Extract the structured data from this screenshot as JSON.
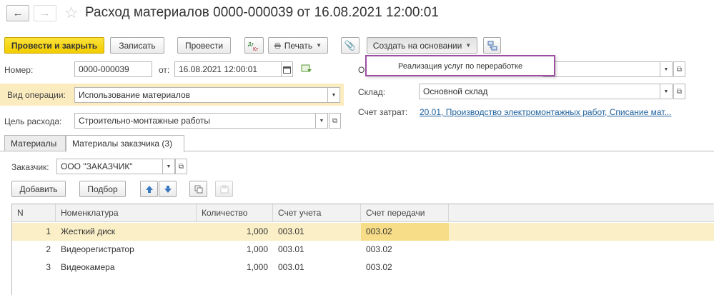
{
  "window": {
    "title": "Расход материалов 0000-000039 от 16.08.2021 12:00:01"
  },
  "toolbar": {
    "post_close": "Провести и закрыть",
    "save": "Записать",
    "post": "Провести",
    "print": "Печать",
    "create_based": "Создать на основании"
  },
  "popup": {
    "item": "Реализация услуг по переработке"
  },
  "form": {
    "number_label": "Номер:",
    "number_value": "0000-000039",
    "date_label": "от:",
    "date_value": "16.08.2021 12:00:01",
    "org_label_partial": "О",
    "op_label": "Вид операции:",
    "op_value": "Использование материалов",
    "purpose_label": "Цель расхода:",
    "purpose_value": "Строительно-монтажные работы",
    "warehouse_label": "Склад:",
    "warehouse_value": "Основной склад",
    "cost_label": "Счет затрат:",
    "cost_value": "20.01, Производство электромонтажных работ, Списание мат..."
  },
  "tabs": [
    {
      "label": "Материалы"
    },
    {
      "label": "Материалы заказчика (3)"
    }
  ],
  "customer": {
    "label": "Заказчик:",
    "value": "ООО \"ЗАКАЗЧИК\""
  },
  "table_toolbar": {
    "add": "Добавить",
    "select": "Подбор"
  },
  "table": {
    "headers": [
      "N",
      "Номенклатура",
      "Количество",
      "Счет учета",
      "Счет передачи"
    ],
    "rows": [
      {
        "n": "1",
        "name": "Жесткий диск",
        "qty": "1,000",
        "account": "003.01",
        "transfer": "003.02"
      },
      {
        "n": "2",
        "name": "Видеорегистратор",
        "qty": "1,000",
        "account": "003.01",
        "transfer": "003.02"
      },
      {
        "n": "3",
        "name": "Видеокамера",
        "qty": "1,000",
        "account": "003.01",
        "transfer": "003.02"
      }
    ]
  },
  "colors": {
    "primary_button": "#f3cc00",
    "highlight_band": "#fbecc0",
    "selected_row": "#faefc7",
    "link": "#1c5f9c",
    "popup_border": "#9c4fa0"
  }
}
